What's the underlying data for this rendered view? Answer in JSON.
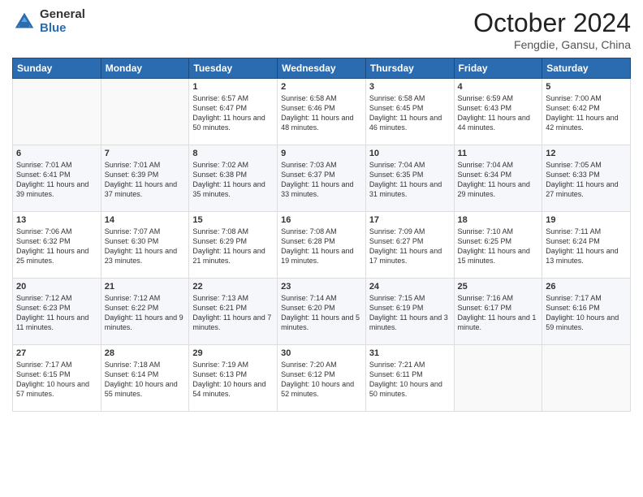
{
  "logo": {
    "general": "General",
    "blue": "Blue"
  },
  "header": {
    "month": "October 2024",
    "location": "Fengdie, Gansu, China"
  },
  "weekdays": [
    "Sunday",
    "Monday",
    "Tuesday",
    "Wednesday",
    "Thursday",
    "Friday",
    "Saturday"
  ],
  "weeks": [
    [
      {
        "day": "",
        "sunrise": "",
        "sunset": "",
        "daylight": ""
      },
      {
        "day": "",
        "sunrise": "",
        "sunset": "",
        "daylight": ""
      },
      {
        "day": "1",
        "sunrise": "Sunrise: 6:57 AM",
        "sunset": "Sunset: 6:47 PM",
        "daylight": "Daylight: 11 hours and 50 minutes."
      },
      {
        "day": "2",
        "sunrise": "Sunrise: 6:58 AM",
        "sunset": "Sunset: 6:46 PM",
        "daylight": "Daylight: 11 hours and 48 minutes."
      },
      {
        "day": "3",
        "sunrise": "Sunrise: 6:58 AM",
        "sunset": "Sunset: 6:45 PM",
        "daylight": "Daylight: 11 hours and 46 minutes."
      },
      {
        "day": "4",
        "sunrise": "Sunrise: 6:59 AM",
        "sunset": "Sunset: 6:43 PM",
        "daylight": "Daylight: 11 hours and 44 minutes."
      },
      {
        "day": "5",
        "sunrise": "Sunrise: 7:00 AM",
        "sunset": "Sunset: 6:42 PM",
        "daylight": "Daylight: 11 hours and 42 minutes."
      }
    ],
    [
      {
        "day": "6",
        "sunrise": "Sunrise: 7:01 AM",
        "sunset": "Sunset: 6:41 PM",
        "daylight": "Daylight: 11 hours and 39 minutes."
      },
      {
        "day": "7",
        "sunrise": "Sunrise: 7:01 AM",
        "sunset": "Sunset: 6:39 PM",
        "daylight": "Daylight: 11 hours and 37 minutes."
      },
      {
        "day": "8",
        "sunrise": "Sunrise: 7:02 AM",
        "sunset": "Sunset: 6:38 PM",
        "daylight": "Daylight: 11 hours and 35 minutes."
      },
      {
        "day": "9",
        "sunrise": "Sunrise: 7:03 AM",
        "sunset": "Sunset: 6:37 PM",
        "daylight": "Daylight: 11 hours and 33 minutes."
      },
      {
        "day": "10",
        "sunrise": "Sunrise: 7:04 AM",
        "sunset": "Sunset: 6:35 PM",
        "daylight": "Daylight: 11 hours and 31 minutes."
      },
      {
        "day": "11",
        "sunrise": "Sunrise: 7:04 AM",
        "sunset": "Sunset: 6:34 PM",
        "daylight": "Daylight: 11 hours and 29 minutes."
      },
      {
        "day": "12",
        "sunrise": "Sunrise: 7:05 AM",
        "sunset": "Sunset: 6:33 PM",
        "daylight": "Daylight: 11 hours and 27 minutes."
      }
    ],
    [
      {
        "day": "13",
        "sunrise": "Sunrise: 7:06 AM",
        "sunset": "Sunset: 6:32 PM",
        "daylight": "Daylight: 11 hours and 25 minutes."
      },
      {
        "day": "14",
        "sunrise": "Sunrise: 7:07 AM",
        "sunset": "Sunset: 6:30 PM",
        "daylight": "Daylight: 11 hours and 23 minutes."
      },
      {
        "day": "15",
        "sunrise": "Sunrise: 7:08 AM",
        "sunset": "Sunset: 6:29 PM",
        "daylight": "Daylight: 11 hours and 21 minutes."
      },
      {
        "day": "16",
        "sunrise": "Sunrise: 7:08 AM",
        "sunset": "Sunset: 6:28 PM",
        "daylight": "Daylight: 11 hours and 19 minutes."
      },
      {
        "day": "17",
        "sunrise": "Sunrise: 7:09 AM",
        "sunset": "Sunset: 6:27 PM",
        "daylight": "Daylight: 11 hours and 17 minutes."
      },
      {
        "day": "18",
        "sunrise": "Sunrise: 7:10 AM",
        "sunset": "Sunset: 6:25 PM",
        "daylight": "Daylight: 11 hours and 15 minutes."
      },
      {
        "day": "19",
        "sunrise": "Sunrise: 7:11 AM",
        "sunset": "Sunset: 6:24 PM",
        "daylight": "Daylight: 11 hours and 13 minutes."
      }
    ],
    [
      {
        "day": "20",
        "sunrise": "Sunrise: 7:12 AM",
        "sunset": "Sunset: 6:23 PM",
        "daylight": "Daylight: 11 hours and 11 minutes."
      },
      {
        "day": "21",
        "sunrise": "Sunrise: 7:12 AM",
        "sunset": "Sunset: 6:22 PM",
        "daylight": "Daylight: 11 hours and 9 minutes."
      },
      {
        "day": "22",
        "sunrise": "Sunrise: 7:13 AM",
        "sunset": "Sunset: 6:21 PM",
        "daylight": "Daylight: 11 hours and 7 minutes."
      },
      {
        "day": "23",
        "sunrise": "Sunrise: 7:14 AM",
        "sunset": "Sunset: 6:20 PM",
        "daylight": "Daylight: 11 hours and 5 minutes."
      },
      {
        "day": "24",
        "sunrise": "Sunrise: 7:15 AM",
        "sunset": "Sunset: 6:19 PM",
        "daylight": "Daylight: 11 hours and 3 minutes."
      },
      {
        "day": "25",
        "sunrise": "Sunrise: 7:16 AM",
        "sunset": "Sunset: 6:17 PM",
        "daylight": "Daylight: 11 hours and 1 minute."
      },
      {
        "day": "26",
        "sunrise": "Sunrise: 7:17 AM",
        "sunset": "Sunset: 6:16 PM",
        "daylight": "Daylight: 10 hours and 59 minutes."
      }
    ],
    [
      {
        "day": "27",
        "sunrise": "Sunrise: 7:17 AM",
        "sunset": "Sunset: 6:15 PM",
        "daylight": "Daylight: 10 hours and 57 minutes."
      },
      {
        "day": "28",
        "sunrise": "Sunrise: 7:18 AM",
        "sunset": "Sunset: 6:14 PM",
        "daylight": "Daylight: 10 hours and 55 minutes."
      },
      {
        "day": "29",
        "sunrise": "Sunrise: 7:19 AM",
        "sunset": "Sunset: 6:13 PM",
        "daylight": "Daylight: 10 hours and 54 minutes."
      },
      {
        "day": "30",
        "sunrise": "Sunrise: 7:20 AM",
        "sunset": "Sunset: 6:12 PM",
        "daylight": "Daylight: 10 hours and 52 minutes."
      },
      {
        "day": "31",
        "sunrise": "Sunrise: 7:21 AM",
        "sunset": "Sunset: 6:11 PM",
        "daylight": "Daylight: 10 hours and 50 minutes."
      },
      {
        "day": "",
        "sunrise": "",
        "sunset": "",
        "daylight": ""
      },
      {
        "day": "",
        "sunrise": "",
        "sunset": "",
        "daylight": ""
      }
    ]
  ]
}
